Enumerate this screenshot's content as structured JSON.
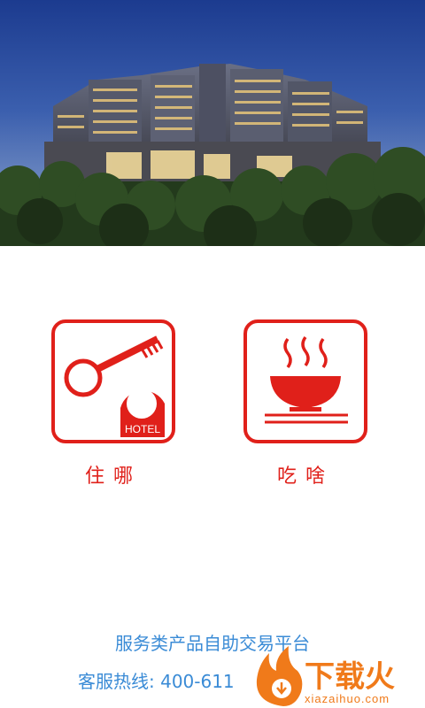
{
  "tiles": [
    {
      "label": "住哪",
      "icon": "hotel-key-icon",
      "badge_text": "HOTEL"
    },
    {
      "label": "吃啥",
      "icon": "noodle-bowl-icon"
    }
  ],
  "footer": {
    "tagline": "服务类产品自助交易平台",
    "hotline": "客服热线: 400-611"
  },
  "watermark": {
    "brand": "下载火",
    "url": "xiazaihuo.com"
  },
  "colors": {
    "accent": "#e0201a",
    "footer_text": "#3a8bd6",
    "watermark_orange": "#f07a1a"
  }
}
